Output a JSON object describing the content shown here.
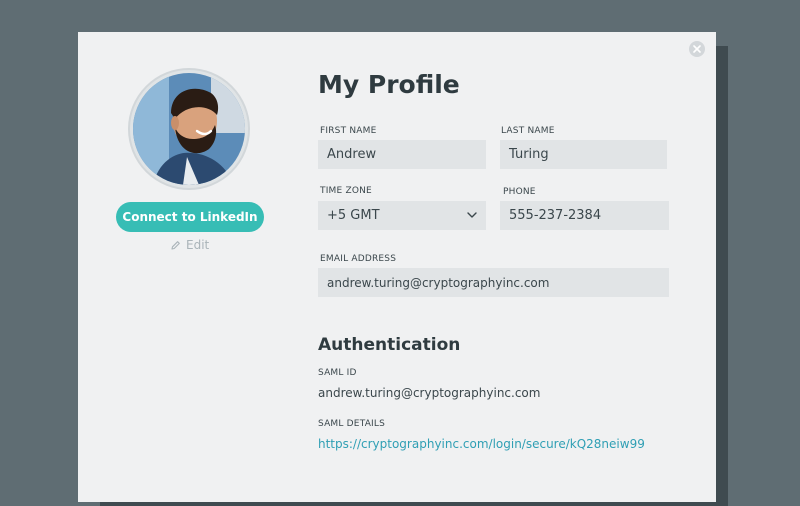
{
  "sidebar": {
    "connect_label": "Connect to LinkedIn",
    "edit_label": "Edit"
  },
  "profile": {
    "title": "My Profile",
    "first_name_label": "FIRST NAME",
    "first_name": "Andrew",
    "last_name_label": "LAST NAME",
    "last_name": "Turing",
    "time_zone_label": "TIME ZONE",
    "time_zone": "+5 GMT",
    "phone_label": "PHONE",
    "phone": "555-237-2384",
    "email_label": "EMAIL ADDRESS",
    "email": "andrew.turing@cryptographyinc.com"
  },
  "auth": {
    "title": "Authentication",
    "saml_id_label": "SAML ID",
    "saml_id": "andrew.turing@cryptographyinc.com",
    "saml_details_label": "SAML DETAILS",
    "saml_details": "https://cryptographyinc.com/login/secure/kQ28neiw99"
  },
  "icons": {
    "close": "close-icon",
    "edit": "pencil-icon",
    "dropdown": "chevron-down-icon"
  },
  "colors": {
    "accent": "#37bdb5",
    "link": "#2f9fb4",
    "backdrop": "#5f6d73"
  }
}
